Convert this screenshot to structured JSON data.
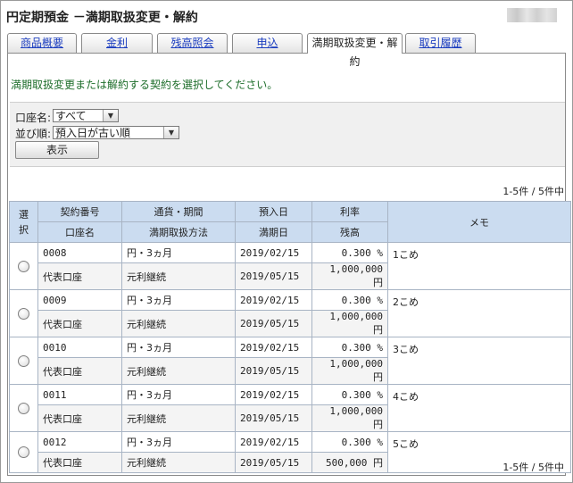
{
  "page": {
    "title": "円定期預金 －満期取扱変更・解約"
  },
  "tabs": [
    {
      "label": "商品概要"
    },
    {
      "label": "金利"
    },
    {
      "label": "残高照会"
    },
    {
      "label": "申込"
    },
    {
      "label": "満期取扱変更・解約"
    },
    {
      "label": "取引履歴"
    }
  ],
  "active_tab_index": 4,
  "instruction": "満期取扱変更または解約する契約を選択してください。",
  "filter": {
    "account_label": "口座名:",
    "account_value": "すべて",
    "sort_label": "並び順:",
    "sort_value": "預入日が古い順",
    "display_button": "表示"
  },
  "count_text": "1-5件 / 5件中",
  "table": {
    "headers": {
      "select": "選択",
      "contract_no": "契約番号",
      "account_name": "口座名",
      "currency_period": "通貨・期間",
      "maturity_method": "満期取扱方法",
      "deposit_date": "預入日",
      "maturity_date": "満期日",
      "rate": "利率",
      "balance": "残高",
      "memo": "メモ"
    },
    "rows": [
      {
        "contract_no": "0008",
        "account_name": "代表口座",
        "currency_period": "円・3ヵ月",
        "maturity_method": "元利継続",
        "deposit_date": "2019/02/15",
        "maturity_date": "2019/05/15",
        "rate": "0.300 %",
        "balance": "1,000,000 円",
        "memo": "1こめ"
      },
      {
        "contract_no": "0009",
        "account_name": "代表口座",
        "currency_period": "円・3ヵ月",
        "maturity_method": "元利継続",
        "deposit_date": "2019/02/15",
        "maturity_date": "2019/05/15",
        "rate": "0.300 %",
        "balance": "1,000,000 円",
        "memo": "2こめ"
      },
      {
        "contract_no": "0010",
        "account_name": "代表口座",
        "currency_period": "円・3ヵ月",
        "maturity_method": "元利継続",
        "deposit_date": "2019/02/15",
        "maturity_date": "2019/05/15",
        "rate": "0.300 %",
        "balance": "1,000,000 円",
        "memo": "3こめ"
      },
      {
        "contract_no": "0011",
        "account_name": "代表口座",
        "currency_period": "円・3ヵ月",
        "maturity_method": "元利継続",
        "deposit_date": "2019/02/15",
        "maturity_date": "2019/05/15",
        "rate": "0.300 %",
        "balance": "1,000,000 円",
        "memo": "4こめ"
      },
      {
        "contract_no": "0012",
        "account_name": "代表口座",
        "currency_period": "円・3ヵ月",
        "maturity_method": "元利継続",
        "deposit_date": "2019/02/15",
        "maturity_date": "2019/05/15",
        "rate": "0.300 %",
        "balance": "500,000 円",
        "memo": "5こめ"
      }
    ]
  },
  "colors": {
    "header_bg": "#cbdcf0",
    "instruction_text": "#1e6e2b",
    "tab_link": "#1a3cbf"
  }
}
